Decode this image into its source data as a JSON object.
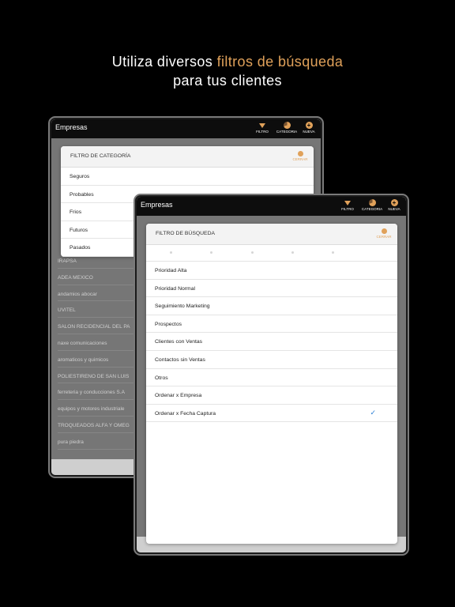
{
  "headline": {
    "line1_prefix": "Utiliza diversos ",
    "line1_accent": "filtros de búsqueda",
    "line2": "para tus clientes"
  },
  "colors": {
    "accent": "#e0a15a",
    "check": "#2a7fd4"
  },
  "back_device": {
    "title": "Empresas",
    "nav": {
      "filter": "FILTRO",
      "category": "CATEGORIA",
      "new": "NUEVA"
    },
    "popup": {
      "title": "FILTRO DE CATEGORÍA",
      "close": "CERRAR",
      "items": [
        "Seguros",
        "Probables",
        "Frios",
        "Futuros",
        "Pasados"
      ]
    },
    "list": [
      "IRAPSA",
      "ADEA MEXICO",
      "andamios abocar",
      "UVITEL",
      "SALON RECIDENCIAL DEL PA",
      "naxe comunicaciones",
      "aromaticos y quimicos",
      "POLIESTIRENO DE SAN LUIS",
      "ferreteria y conducciones S.A",
      "equipos y motores industriale",
      "TROQUEADOS ALFA Y OMEG",
      "pura piedra"
    ]
  },
  "front_device": {
    "title": "Empresas",
    "nav": {
      "filter": "FILTRO",
      "category": "CATEGORIA",
      "new": "NUEVA"
    },
    "popup": {
      "title": "FILTRO DE BÚSQUEDA",
      "close": "CERRAR",
      "items": [
        {
          "label": "Prioridad Alta",
          "checked": false
        },
        {
          "label": "Prioridad Normal",
          "checked": false
        },
        {
          "label": "Seguimiento Marketing",
          "checked": false
        },
        {
          "label": "Prospectos",
          "checked": false
        },
        {
          "label": "Clientes con Ventas",
          "checked": false
        },
        {
          "label": "Contactos sin Ventas",
          "checked": false
        },
        {
          "label": "Otros",
          "checked": false
        },
        {
          "label": "Ordenar x Empresa",
          "checked": false
        },
        {
          "label": "Ordenar x Fecha Captura",
          "checked": true
        }
      ]
    }
  }
}
